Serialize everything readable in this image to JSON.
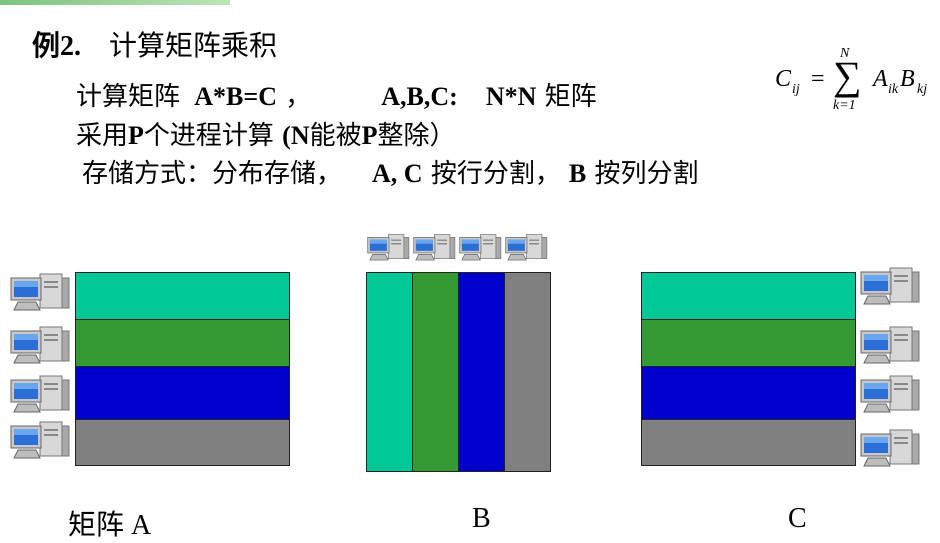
{
  "title": {
    "number": "例2.",
    "text": "计算矩阵乘积"
  },
  "line1": {
    "t1": "计算矩阵 ",
    "eq": "A*B=C",
    "t2": " ，",
    "vars": "A,B,C:",
    "dim": "N*N",
    "t3": " 矩阵"
  },
  "line2": {
    "t1": "采用",
    "p1": "P",
    "t2": "个进程计算 ",
    "p2": "(N",
    "t3": "能被",
    "p3": "P",
    "t4": "整除）"
  },
  "line3": {
    "t1": "存储方式：分布存储，",
    "ac": "A, C",
    "t2": " 按行分割，",
    "b": "B",
    "t3": " 按列分割"
  },
  "formula": {
    "lhs": "C",
    "lhs_sub": "ij",
    "eq": "=",
    "sum_top": "N",
    "sum_bottom": "k=1",
    "a": "A",
    "a_sub": "ik",
    "b": "B",
    "b_sub": "kj"
  },
  "captions": {
    "a": "矩阵 A",
    "b": "B",
    "c": "C"
  },
  "colors": {
    "block1": "#00c896",
    "block2": "#339933",
    "block3": "#0000cc",
    "block4": "#808080"
  },
  "icons": {
    "computer": "desktop-computer-icon"
  }
}
